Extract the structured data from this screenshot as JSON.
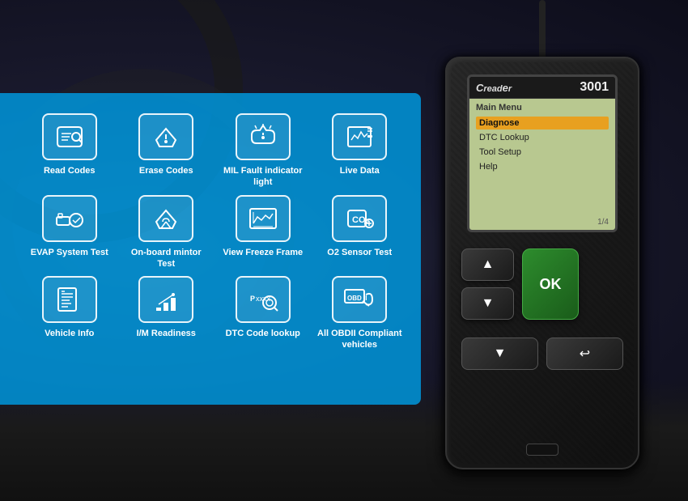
{
  "device": {
    "brand": "Creader",
    "model": "3001",
    "screen": {
      "title": "Main Menu",
      "menu_items": [
        {
          "label": "Diagnose",
          "active": true
        },
        {
          "label": "DTC Lookup",
          "active": false
        },
        {
          "label": "Tool Setup",
          "active": false
        },
        {
          "label": "Help",
          "active": false
        }
      ],
      "page_indicator": "1/4"
    },
    "buttons": {
      "up": "▲",
      "down": "▼",
      "ok": "OK",
      "back": "↩"
    }
  },
  "features": [
    {
      "id": "read-codes",
      "label": "Read Codes",
      "icon": "🔍"
    },
    {
      "id": "erase-codes",
      "label": "Erase Codes",
      "icon": "🚗"
    },
    {
      "id": "mil-fault",
      "label": "MIL Fault indicator light",
      "icon": "⚠"
    },
    {
      "id": "live-data",
      "label": "Live Data",
      "icon": "📋"
    },
    {
      "id": "evap-test",
      "label": "EVAP System Test",
      "icon": "⚡"
    },
    {
      "id": "onboard-monitor",
      "label": "On-board mintor Test",
      "icon": "🛡"
    },
    {
      "id": "freeze-frame",
      "label": "View Freeze Frame",
      "icon": "📊"
    },
    {
      "id": "o2-sensor",
      "label": "O2 Sensor Test",
      "icon": "💨"
    },
    {
      "id": "vehicle-info",
      "label": "Vehicle Info",
      "icon": "📄"
    },
    {
      "id": "im-readiness",
      "label": "I/M Readiness",
      "icon": "📈"
    },
    {
      "id": "dtc-lookup",
      "label": "DTC Code lookup",
      "icon": "🔎"
    },
    {
      "id": "obdii-compliant",
      "label": "All OBDII Compliant vehicles",
      "icon": "🔧"
    }
  ],
  "colors": {
    "banner_blue": "rgba(0,150,220,0.85)",
    "screen_bg": "#b8c890",
    "active_item": "#e8a020",
    "device_body": "#1a1a1a",
    "ok_button": "#2d8c2d"
  }
}
